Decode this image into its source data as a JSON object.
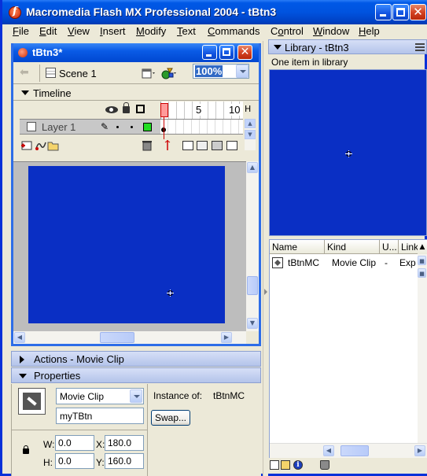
{
  "window": {
    "title": "Macromedia Flash MX Professional 2004 - tBtn3"
  },
  "menu": [
    {
      "label": "File",
      "ul": "F",
      "rest": "ile"
    },
    {
      "label": "Edit",
      "ul": "E",
      "rest": "dit"
    },
    {
      "label": "View",
      "ul": "V",
      "rest": "iew"
    },
    {
      "label": "Insert",
      "ul": "I",
      "rest": "nsert"
    },
    {
      "label": "Modify",
      "ul": "M",
      "rest": "odify"
    },
    {
      "label": "Text",
      "ul": "T",
      "rest": "ext"
    },
    {
      "label": "Commands",
      "ul": "C",
      "rest": "ommands"
    },
    {
      "label": "Control",
      "ul": "",
      "rest": "Control",
      "ul2": "",
      "pre": "C",
      "mid": "o",
      "post": "ntrol"
    },
    {
      "label": "Window",
      "ul": "W",
      "rest": "indow"
    },
    {
      "label": "Help",
      "ul": "H",
      "rest": "elp"
    }
  ],
  "document": {
    "title": "tBtn3*",
    "scene": "Scene 1",
    "zoom": "100%",
    "stage_color": "#0a2fc4"
  },
  "timeline": {
    "label": "Timeline",
    "frame_numbers": [
      "1",
      "5",
      "10"
    ],
    "layers": [
      {
        "name": "Layer 1",
        "outline_color": "#22dd22"
      }
    ]
  },
  "panels": {
    "actions": {
      "title": "Actions - Movie Clip",
      "expanded": false
    },
    "properties": {
      "title": "Properties",
      "symbol_type": "Movie Clip",
      "instance_name": "myTBtn",
      "instance_of_label": "Instance of:",
      "instance_of_value": "tBtnMC",
      "swap_label": "Swap...",
      "w_label": "W:",
      "w": "0.0",
      "h_label": "H:",
      "h": "0.0",
      "x_label": "X:",
      "x": "180.0",
      "y_label": "Y:",
      "y": "160.0"
    }
  },
  "library": {
    "title": "Library - tBtn3",
    "count_text": "One item in library",
    "columns": [
      "Name",
      "Kind",
      "U...",
      "Link"
    ],
    "items": [
      {
        "name": "tBtnMC",
        "kind": "Movie Clip",
        "use": "-",
        "linkage": "Exp"
      }
    ]
  },
  "icons": [
    "flash-app-icon",
    "back-arrow-icon",
    "scene-icon",
    "edit-scene-icon",
    "edit-symbol-icon",
    "eye-icon",
    "lock-icon",
    "outline-icon",
    "pencil-icon",
    "insert-layer-icon",
    "motion-guide-icon",
    "layer-folder-icon",
    "trash-icon",
    "movie-clip-icon",
    "registration-point-icon",
    "properties-icon",
    "info-icon",
    "new-folder-icon",
    "new-symbol-icon",
    "library-options-icon"
  ]
}
